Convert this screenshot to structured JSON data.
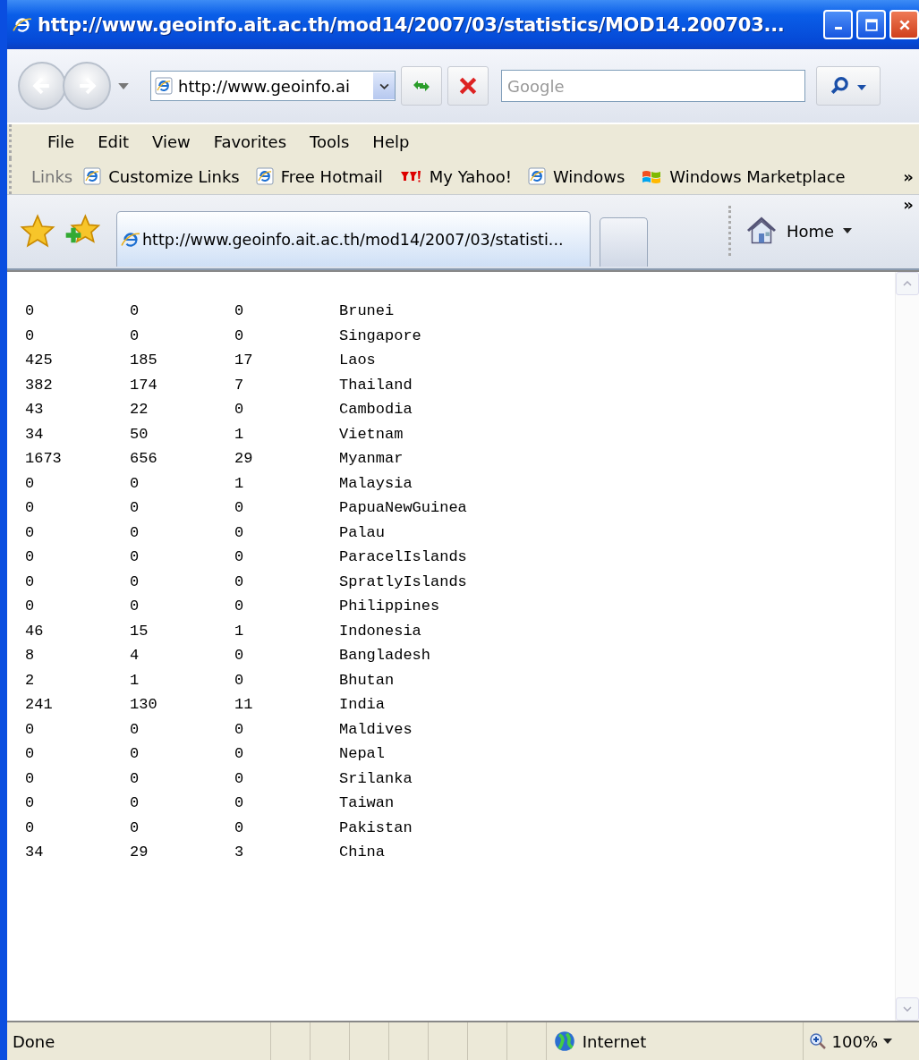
{
  "window": {
    "title": "http://www.geoinfo.ait.ac.th/mod14/2007/03/statistics/MOD14.200703..."
  },
  "address_bar": {
    "value": "http://www.geoinfo.ai"
  },
  "search": {
    "placeholder": "Google"
  },
  "menu": [
    "File",
    "Edit",
    "View",
    "Favorites",
    "Tools",
    "Help"
  ],
  "links": {
    "label": "Links",
    "items": [
      {
        "label": "Customize Links",
        "kind": "ie"
      },
      {
        "label": "Free Hotmail",
        "kind": "ie"
      },
      {
        "label": "My Yahoo!",
        "kind": "yahoo"
      },
      {
        "label": "Windows",
        "kind": "ie"
      },
      {
        "label": "Windows Marketplace",
        "kind": "windows"
      }
    ],
    "overflow": "»"
  },
  "tabs": [
    {
      "title": "http://www.geoinfo.ait.ac.th/mod14/2007/03/statisti...",
      "selected": true
    }
  ],
  "home": {
    "label": "Home"
  },
  "toolbar_overflow": "»",
  "table": {
    "rows": [
      [
        "0",
        "0",
        "0",
        "Brunei"
      ],
      [
        "0",
        "0",
        "0",
        "Singapore"
      ],
      [
        "425",
        "185",
        "17",
        "Laos"
      ],
      [
        "382",
        "174",
        "7",
        "Thailand"
      ],
      [
        "43",
        "22",
        "0",
        "Cambodia"
      ],
      [
        "34",
        "50",
        "1",
        "Vietnam"
      ],
      [
        "1673",
        "656",
        "29",
        "Myanmar"
      ],
      [
        "0",
        "0",
        "1",
        "Malaysia"
      ],
      [
        "0",
        "0",
        "0",
        "PapuaNewGuinea"
      ],
      [
        "0",
        "0",
        "0",
        "Palau"
      ],
      [
        "0",
        "0",
        "0",
        "ParacelIslands"
      ],
      [
        "0",
        "0",
        "0",
        "SpratlyIslands"
      ],
      [
        "0",
        "0",
        "0",
        "Philippines"
      ],
      [
        "46",
        "15",
        "1",
        "Indonesia"
      ],
      [
        "8",
        "4",
        "0",
        "Bangladesh"
      ],
      [
        "2",
        "1",
        "0",
        "Bhutan"
      ],
      [
        "241",
        "130",
        "11",
        "India"
      ],
      [
        "0",
        "0",
        "0",
        "Maldives"
      ],
      [
        "0",
        "0",
        "0",
        "Nepal"
      ],
      [
        "0",
        "0",
        "0",
        "Srilanka"
      ],
      [
        "0",
        "0",
        "0",
        "Taiwan"
      ],
      [
        "0",
        "0",
        "0",
        "Pakistan"
      ],
      [
        "34",
        "29",
        "3",
        "China"
      ]
    ]
  },
  "status_bar": {
    "text": "Done",
    "zone": "Internet",
    "zoom": "100%"
  }
}
